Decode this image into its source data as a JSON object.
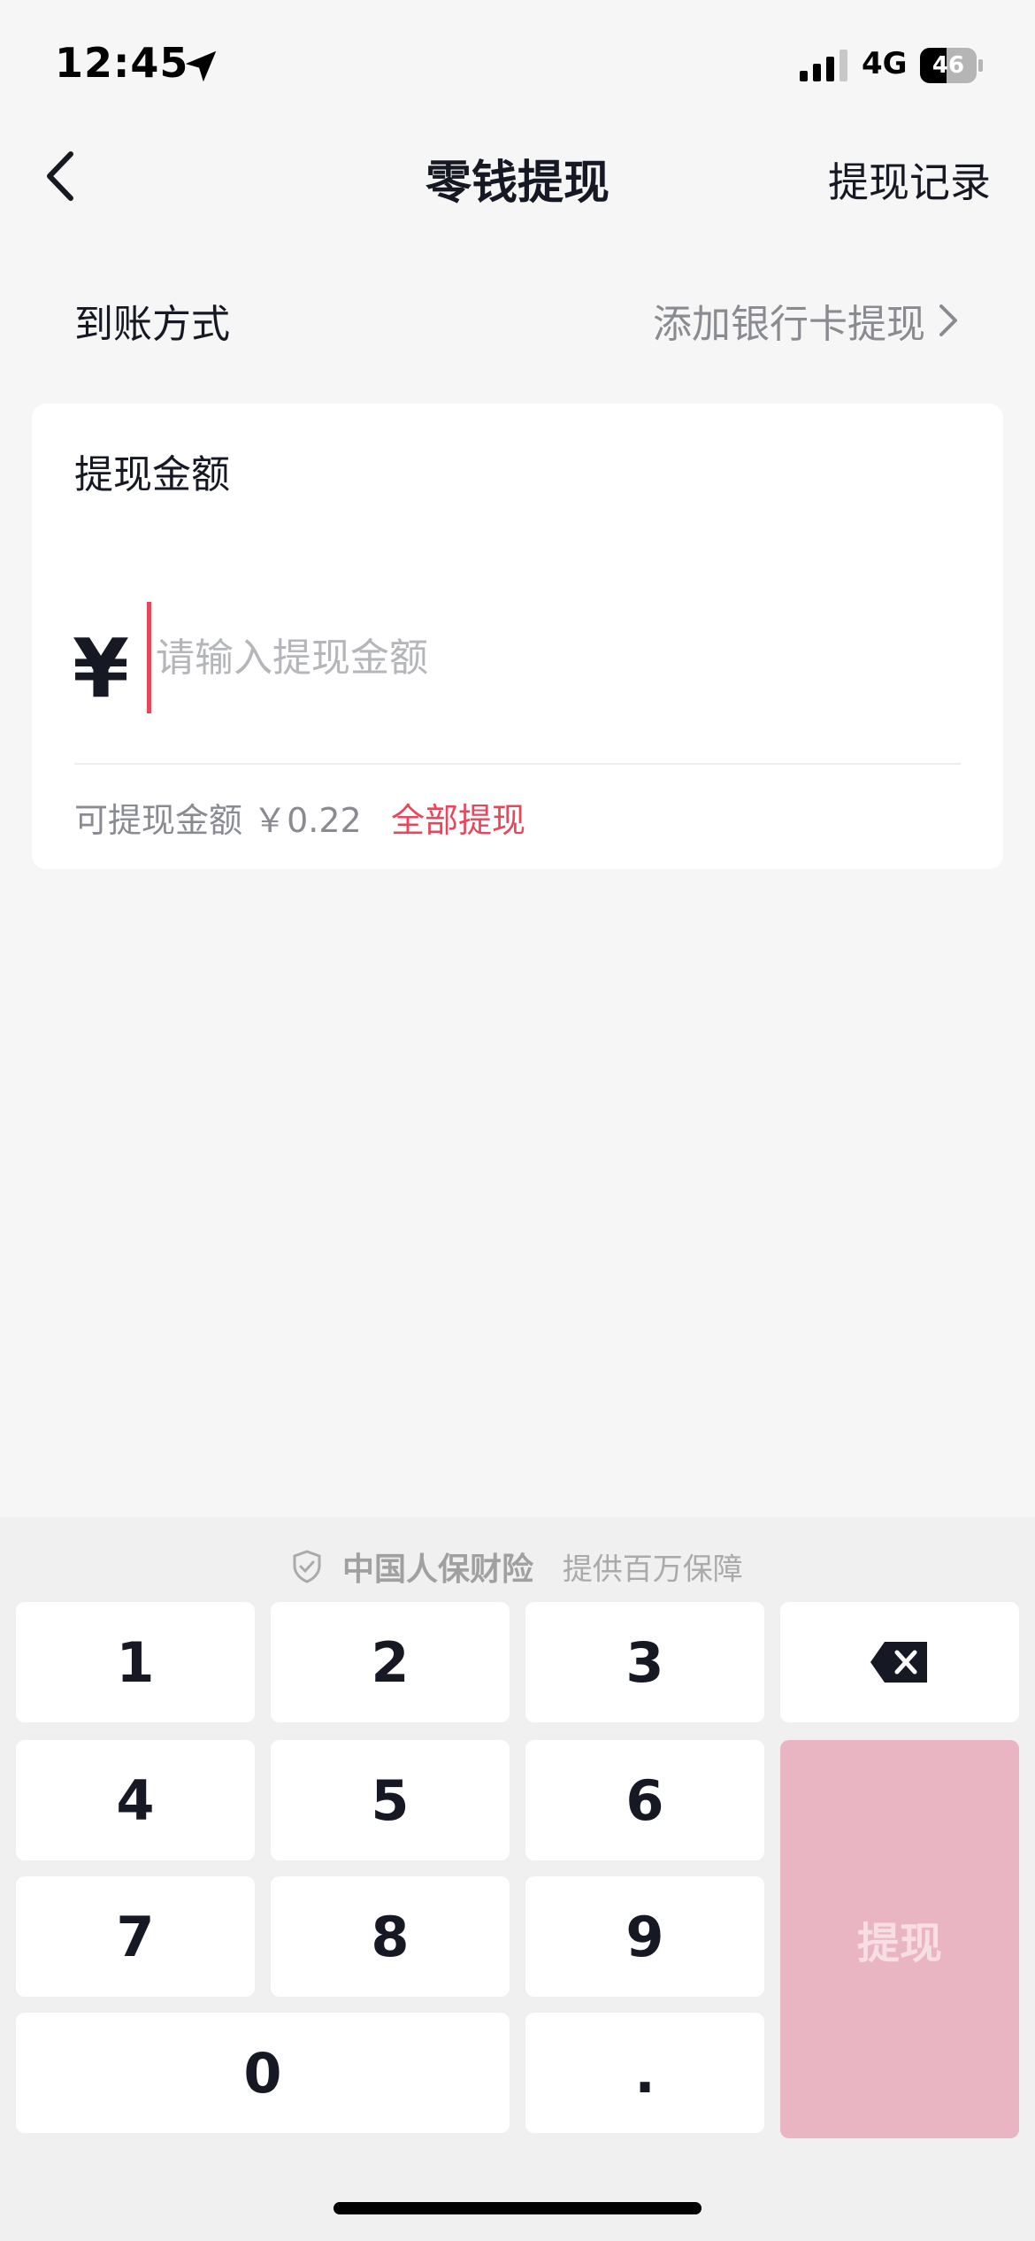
{
  "status_bar": {
    "time": "12:45",
    "network": "4G",
    "battery": "46"
  },
  "nav": {
    "title": "零钱提现",
    "right_action": "提现记录"
  },
  "payout_method": {
    "label": "到账方式",
    "value": "添加银行卡提现"
  },
  "amount_card": {
    "title": "提现金额",
    "currency_symbol": "¥",
    "input_value": "",
    "input_placeholder": "请输入提现金额",
    "available_label": "可提现金额 ￥0.22",
    "withdraw_all": "全部提现"
  },
  "keyboard": {
    "insurer": "中国人保财险",
    "tagline": "提供百万保障",
    "keys": {
      "k1": "1",
      "k2": "2",
      "k3": "3",
      "k4": "4",
      "k5": "5",
      "k6": "6",
      "k7": "7",
      "k8": "8",
      "k9": "9",
      "k0": "0",
      "dot": "."
    },
    "submit": "提现"
  },
  "colors": {
    "accent": "#e8465b",
    "submit_disabled": "#e9b5c2",
    "background": "#f6f6f6"
  },
  "icons": [
    "location-arrow-icon",
    "signal-icon",
    "battery-icon",
    "back-arrow-icon",
    "chevron-right-icon",
    "shield-check-icon",
    "backspace-icon"
  ]
}
